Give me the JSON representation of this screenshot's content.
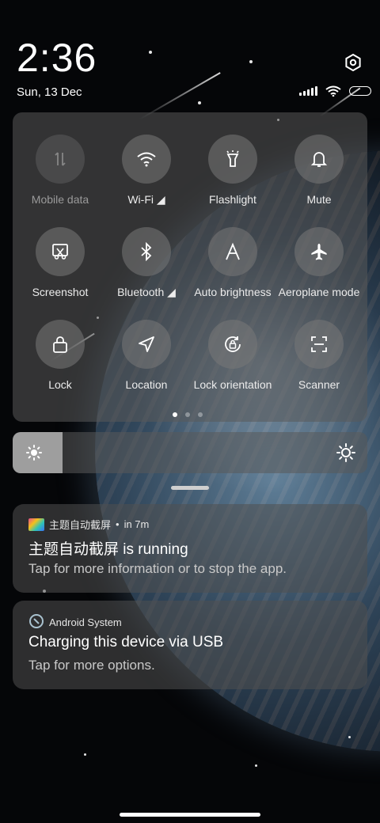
{
  "status_bar": {
    "time": "2:36",
    "date": "Sun, 13 Dec"
  },
  "quick_settings": {
    "tiles": [
      {
        "label": "Mobile data",
        "icon": "mobile-data-icon",
        "active": false
      },
      {
        "label": "Wi-Fi ◢",
        "icon": "wifi-icon",
        "active": true
      },
      {
        "label": "Flashlight",
        "icon": "flashlight-icon",
        "active": true
      },
      {
        "label": "Mute",
        "icon": "bell-icon",
        "active": true
      },
      {
        "label": "Screenshot",
        "icon": "screenshot-icon",
        "active": true
      },
      {
        "label": "Bluetooth ◢",
        "icon": "bluetooth-icon",
        "active": true
      },
      {
        "label": "Auto brightness",
        "icon": "auto-brightness-icon",
        "active": true
      },
      {
        "label": "Aeroplane mode",
        "icon": "airplane-icon",
        "active": true
      },
      {
        "label": "Lock",
        "icon": "lock-icon",
        "active": true
      },
      {
        "label": "Location",
        "icon": "location-icon",
        "active": true
      },
      {
        "label": "Lock orientation",
        "icon": "rotation-lock-icon",
        "active": true
      },
      {
        "label": "Scanner",
        "icon": "scanner-icon",
        "active": true
      }
    ],
    "page_indicator": {
      "pages": 3,
      "current": 1
    }
  },
  "brightness": {
    "level_fraction": 0.14
  },
  "notifications": [
    {
      "app": "主题自动截屏",
      "time": "in 7m",
      "title": "主题自动截屏 is running",
      "body": "Tap for more information or to stop the app."
    },
    {
      "app": "Android System",
      "title": "Charging this device via USB",
      "body": "Tap for more options."
    }
  ],
  "colors": {
    "panel": "#5a5a5a",
    "tile": "#787878",
    "brightness_fill": "#9e9e9e"
  }
}
